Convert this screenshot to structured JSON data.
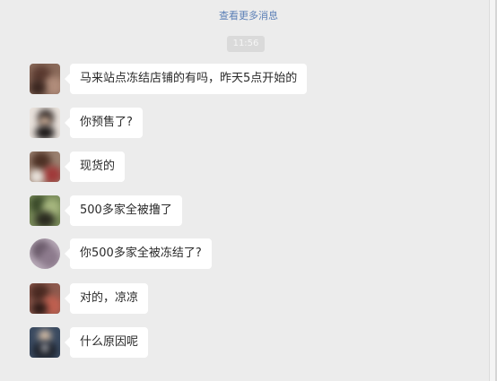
{
  "chat": {
    "more_link": "查看更多消息",
    "time": "11:56",
    "messages": [
      {
        "text": "马来站点冻结店铺的有吗，昨天5点开始的"
      },
      {
        "text": "你预售了?"
      },
      {
        "text": "现货的"
      },
      {
        "text": "500多家全被撸了"
      },
      {
        "text": "你500多家全被冻结了?"
      },
      {
        "text": "对的，凉凉"
      },
      {
        "text": "什么原因呢"
      }
    ]
  }
}
